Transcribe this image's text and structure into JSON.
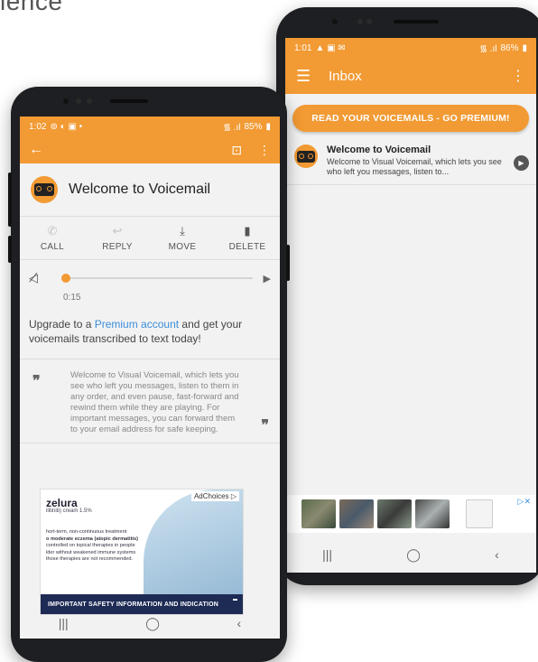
{
  "corner_text": "ience",
  "back_phone": {
    "status": {
      "time": "1:01",
      "icons_left": "▲ ▣ ✉",
      "signal": "᯾ .ıl",
      "battery": "86%"
    },
    "appbar": {
      "menu": "☰",
      "title": "Inbox",
      "overflow": "⋮"
    },
    "premium_banner": "READ YOUR VOICEMAILS - GO PREMIUM!",
    "inbox": [
      {
        "title": "Welcome to Voicemail",
        "snippet": "Welcome to Visual Voicemail, which lets you see who left you messages, listen to..."
      }
    ],
    "ad_choices": "▷✕",
    "nav": {
      "recents": "|||",
      "home": "◯",
      "back": "‹"
    }
  },
  "front_phone": {
    "status": {
      "time": "1:02",
      "icons_left": "⊚ ◐ ▣ •",
      "signal": "᯾ .ıl",
      "battery": "85%"
    },
    "appbar": {
      "back": "←",
      "lock": "🔒",
      "overflow": "⋮"
    },
    "message_title": "Welcome to Voicemail",
    "actions": [
      {
        "label": "CALL",
        "icon": "✆"
      },
      {
        "label": "REPLY",
        "icon": "↩"
      },
      {
        "label": "MOVE",
        "icon": "⤓"
      },
      {
        "label": "DELETE",
        "icon": "🗑"
      }
    ],
    "player": {
      "mute": "🔇",
      "play": "▶",
      "time": "0:15"
    },
    "upgrade": {
      "prefix": "Upgrade to a ",
      "link": "Premium account",
      "suffix": " and get your voicemails transcribed to text today!"
    },
    "transcript": {
      "quote_open": "❞",
      "quote_close": "❞",
      "text": "Welcome to Visual Voicemail, which lets you see who left you messages, listen to them in any order, and even pause, fast-forward and rewind them while they are playing. For important messages, you can forward them to your email address for safe keeping."
    },
    "ad": {
      "choices": "AdChoices ▷",
      "brand": "zelura",
      "sub": "ilitinib) cream 1.5%",
      "lines": [
        "hort-term, non-continuous treatment",
        "o moderate eczema (atopic dermatitis)",
        "controlled on topical therapies in people",
        "lder without weakened immune systems",
        "those therapies are not recommended."
      ],
      "footer": "IMPORTANT SAFETY INFORMATION AND INDICATION"
    },
    "nav": {
      "recents": "|||",
      "home": "◯",
      "back": "‹"
    }
  },
  "colors": {
    "accent": "#f29a33",
    "link": "#3c8edb",
    "ad_navy": "#1e2b55"
  }
}
